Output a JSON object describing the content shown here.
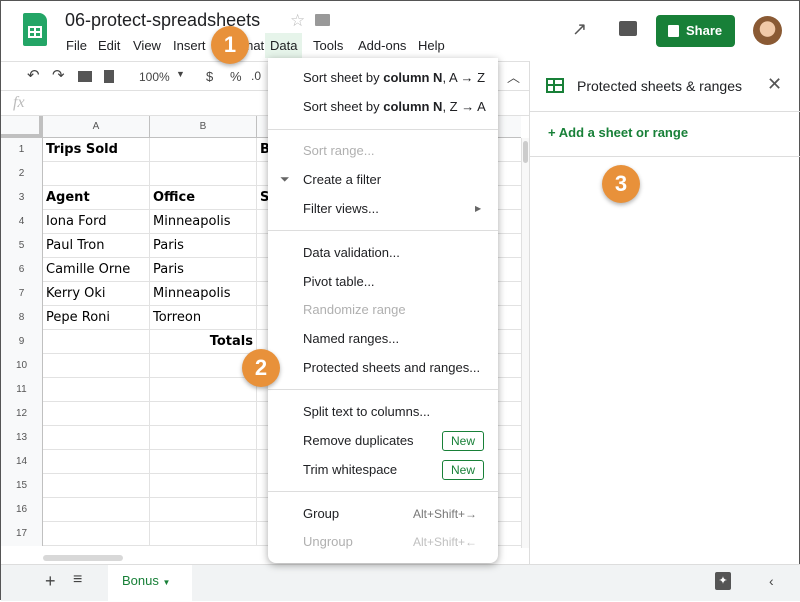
{
  "app": {
    "title": "06-protect-spreadsheets",
    "share_label": "Share"
  },
  "menubar": [
    "File",
    "Edit",
    "View",
    "Insert",
    "Format",
    "Data",
    "Tools",
    "Add-ons",
    "Help"
  ],
  "toolbar": {
    "zoom": "100%",
    "currency": "$",
    "percent": "%",
    "decimal": ".0"
  },
  "formula_bar": {
    "fx": "fx"
  },
  "columns": [
    "A",
    "B"
  ],
  "rows": [
    {
      "n": "1",
      "a": "Trips Sold",
      "b": "",
      "c": "B",
      "bold": true
    },
    {
      "n": "2",
      "a": "",
      "b": "",
      "c": ""
    },
    {
      "n": "3",
      "a": "Agent",
      "b": "Office",
      "c": "S",
      "bold": true
    },
    {
      "n": "4",
      "a": "Iona Ford",
      "b": "Minneapolis",
      "c": ""
    },
    {
      "n": "5",
      "a": "Paul Tron",
      "b": "Paris",
      "c": ""
    },
    {
      "n": "6",
      "a": "Camille Orne",
      "b": "Paris",
      "c": ""
    },
    {
      "n": "7",
      "a": "Kerry Oki",
      "b": "Minneapolis",
      "c": ""
    },
    {
      "n": "8",
      "a": "Pepe Roni",
      "b": "Torreon",
      "c": ""
    },
    {
      "n": "9",
      "a": "",
      "b": "Totals",
      "c": "",
      "bold": true
    },
    {
      "n": "10"
    },
    {
      "n": "11"
    },
    {
      "n": "12"
    },
    {
      "n": "13"
    },
    {
      "n": "14"
    },
    {
      "n": "15"
    },
    {
      "n": "16"
    },
    {
      "n": "17"
    }
  ],
  "data_menu": {
    "sort_az_pre": "Sort sheet by ",
    "sort_col": "column N",
    "sort_az_post": ", A → Z",
    "sort_za_post": ", Z → A",
    "sort_range": "Sort range...",
    "create_filter": "Create a filter",
    "filter_views": "Filter views...",
    "data_validation": "Data validation...",
    "pivot_table": "Pivot table...",
    "randomize": "Randomize range",
    "named_ranges": "Named ranges...",
    "protected": "Protected sheets and ranges...",
    "split_text": "Split text to columns...",
    "remove_duplicates": "Remove duplicates",
    "trim_whitespace": "Trim whitespace",
    "new_badge": "New",
    "group": "Group",
    "group_shortcut": "Alt+Shift+→",
    "ungroup": "Ungroup",
    "ungroup_shortcut": "Alt+Shift+←"
  },
  "side_panel": {
    "title": "Protected sheets & ranges",
    "add_label": "Add a sheet or range"
  },
  "callouts": [
    "1",
    "2",
    "3"
  ],
  "sheet_tabs": {
    "active": "Bonus"
  },
  "colors": {
    "accent": "#188038",
    "callout": "#e8913a"
  }
}
